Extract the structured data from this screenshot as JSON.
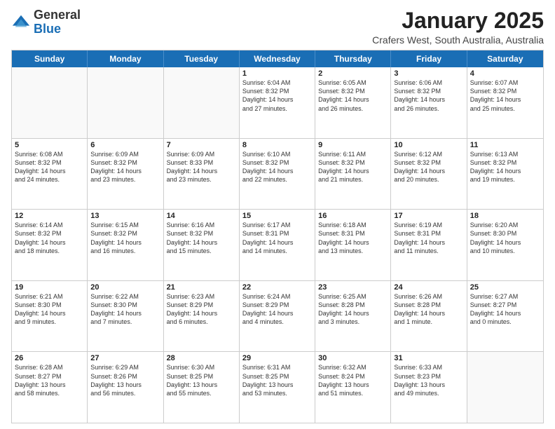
{
  "header": {
    "logo_general": "General",
    "logo_blue": "Blue",
    "month_title": "January 2025",
    "location": "Crafers West, South Australia, Australia"
  },
  "weekdays": [
    "Sunday",
    "Monday",
    "Tuesday",
    "Wednesday",
    "Thursday",
    "Friday",
    "Saturday"
  ],
  "rows": [
    [
      {
        "day": "",
        "info": ""
      },
      {
        "day": "",
        "info": ""
      },
      {
        "day": "",
        "info": ""
      },
      {
        "day": "1",
        "info": "Sunrise: 6:04 AM\nSunset: 8:32 PM\nDaylight: 14 hours\nand 27 minutes."
      },
      {
        "day": "2",
        "info": "Sunrise: 6:05 AM\nSunset: 8:32 PM\nDaylight: 14 hours\nand 26 minutes."
      },
      {
        "day": "3",
        "info": "Sunrise: 6:06 AM\nSunset: 8:32 PM\nDaylight: 14 hours\nand 26 minutes."
      },
      {
        "day": "4",
        "info": "Sunrise: 6:07 AM\nSunset: 8:32 PM\nDaylight: 14 hours\nand 25 minutes."
      }
    ],
    [
      {
        "day": "5",
        "info": "Sunrise: 6:08 AM\nSunset: 8:32 PM\nDaylight: 14 hours\nand 24 minutes."
      },
      {
        "day": "6",
        "info": "Sunrise: 6:09 AM\nSunset: 8:32 PM\nDaylight: 14 hours\nand 23 minutes."
      },
      {
        "day": "7",
        "info": "Sunrise: 6:09 AM\nSunset: 8:33 PM\nDaylight: 14 hours\nand 23 minutes."
      },
      {
        "day": "8",
        "info": "Sunrise: 6:10 AM\nSunset: 8:32 PM\nDaylight: 14 hours\nand 22 minutes."
      },
      {
        "day": "9",
        "info": "Sunrise: 6:11 AM\nSunset: 8:32 PM\nDaylight: 14 hours\nand 21 minutes."
      },
      {
        "day": "10",
        "info": "Sunrise: 6:12 AM\nSunset: 8:32 PM\nDaylight: 14 hours\nand 20 minutes."
      },
      {
        "day": "11",
        "info": "Sunrise: 6:13 AM\nSunset: 8:32 PM\nDaylight: 14 hours\nand 19 minutes."
      }
    ],
    [
      {
        "day": "12",
        "info": "Sunrise: 6:14 AM\nSunset: 8:32 PM\nDaylight: 14 hours\nand 18 minutes."
      },
      {
        "day": "13",
        "info": "Sunrise: 6:15 AM\nSunset: 8:32 PM\nDaylight: 14 hours\nand 16 minutes."
      },
      {
        "day": "14",
        "info": "Sunrise: 6:16 AM\nSunset: 8:32 PM\nDaylight: 14 hours\nand 15 minutes."
      },
      {
        "day": "15",
        "info": "Sunrise: 6:17 AM\nSunset: 8:31 PM\nDaylight: 14 hours\nand 14 minutes."
      },
      {
        "day": "16",
        "info": "Sunrise: 6:18 AM\nSunset: 8:31 PM\nDaylight: 14 hours\nand 13 minutes."
      },
      {
        "day": "17",
        "info": "Sunrise: 6:19 AM\nSunset: 8:31 PM\nDaylight: 14 hours\nand 11 minutes."
      },
      {
        "day": "18",
        "info": "Sunrise: 6:20 AM\nSunset: 8:30 PM\nDaylight: 14 hours\nand 10 minutes."
      }
    ],
    [
      {
        "day": "19",
        "info": "Sunrise: 6:21 AM\nSunset: 8:30 PM\nDaylight: 14 hours\nand 9 minutes."
      },
      {
        "day": "20",
        "info": "Sunrise: 6:22 AM\nSunset: 8:30 PM\nDaylight: 14 hours\nand 7 minutes."
      },
      {
        "day": "21",
        "info": "Sunrise: 6:23 AM\nSunset: 8:29 PM\nDaylight: 14 hours\nand 6 minutes."
      },
      {
        "day": "22",
        "info": "Sunrise: 6:24 AM\nSunset: 8:29 PM\nDaylight: 14 hours\nand 4 minutes."
      },
      {
        "day": "23",
        "info": "Sunrise: 6:25 AM\nSunset: 8:28 PM\nDaylight: 14 hours\nand 3 minutes."
      },
      {
        "day": "24",
        "info": "Sunrise: 6:26 AM\nSunset: 8:28 PM\nDaylight: 14 hours\nand 1 minute."
      },
      {
        "day": "25",
        "info": "Sunrise: 6:27 AM\nSunset: 8:27 PM\nDaylight: 14 hours\nand 0 minutes."
      }
    ],
    [
      {
        "day": "26",
        "info": "Sunrise: 6:28 AM\nSunset: 8:27 PM\nDaylight: 13 hours\nand 58 minutes."
      },
      {
        "day": "27",
        "info": "Sunrise: 6:29 AM\nSunset: 8:26 PM\nDaylight: 13 hours\nand 56 minutes."
      },
      {
        "day": "28",
        "info": "Sunrise: 6:30 AM\nSunset: 8:25 PM\nDaylight: 13 hours\nand 55 minutes."
      },
      {
        "day": "29",
        "info": "Sunrise: 6:31 AM\nSunset: 8:25 PM\nDaylight: 13 hours\nand 53 minutes."
      },
      {
        "day": "30",
        "info": "Sunrise: 6:32 AM\nSunset: 8:24 PM\nDaylight: 13 hours\nand 51 minutes."
      },
      {
        "day": "31",
        "info": "Sunrise: 6:33 AM\nSunset: 8:23 PM\nDaylight: 13 hours\nand 49 minutes."
      },
      {
        "day": "",
        "info": ""
      }
    ]
  ]
}
